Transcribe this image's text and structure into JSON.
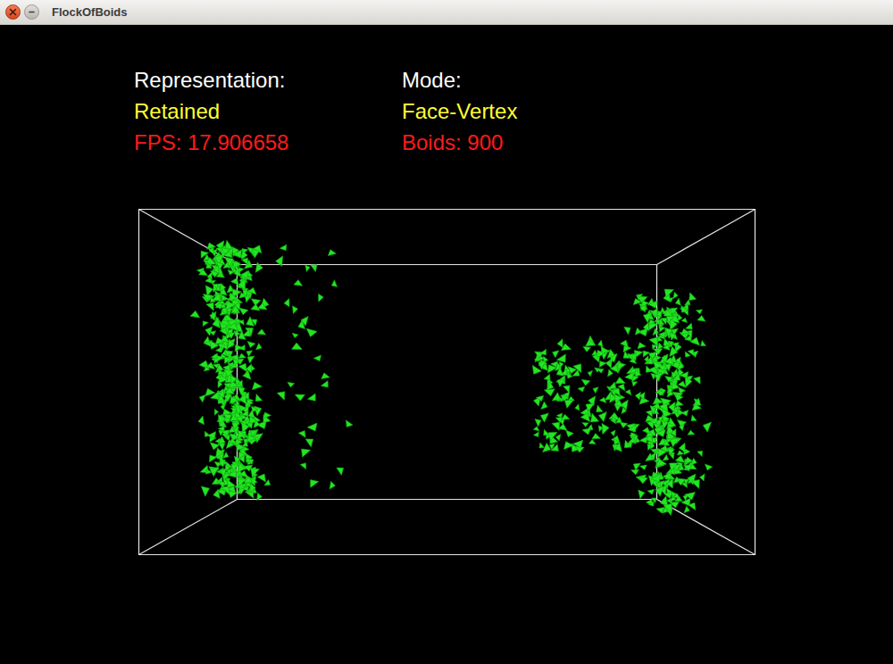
{
  "window": {
    "title": "FlockOfBoids"
  },
  "hud": {
    "columns": [
      {
        "heading": "Representation:",
        "value": "Retained",
        "stat": "FPS: 17.906658"
      },
      {
        "heading": "Mode:",
        "value": "Face-Vertex",
        "stat": "Boids: 900"
      }
    ]
  }
}
